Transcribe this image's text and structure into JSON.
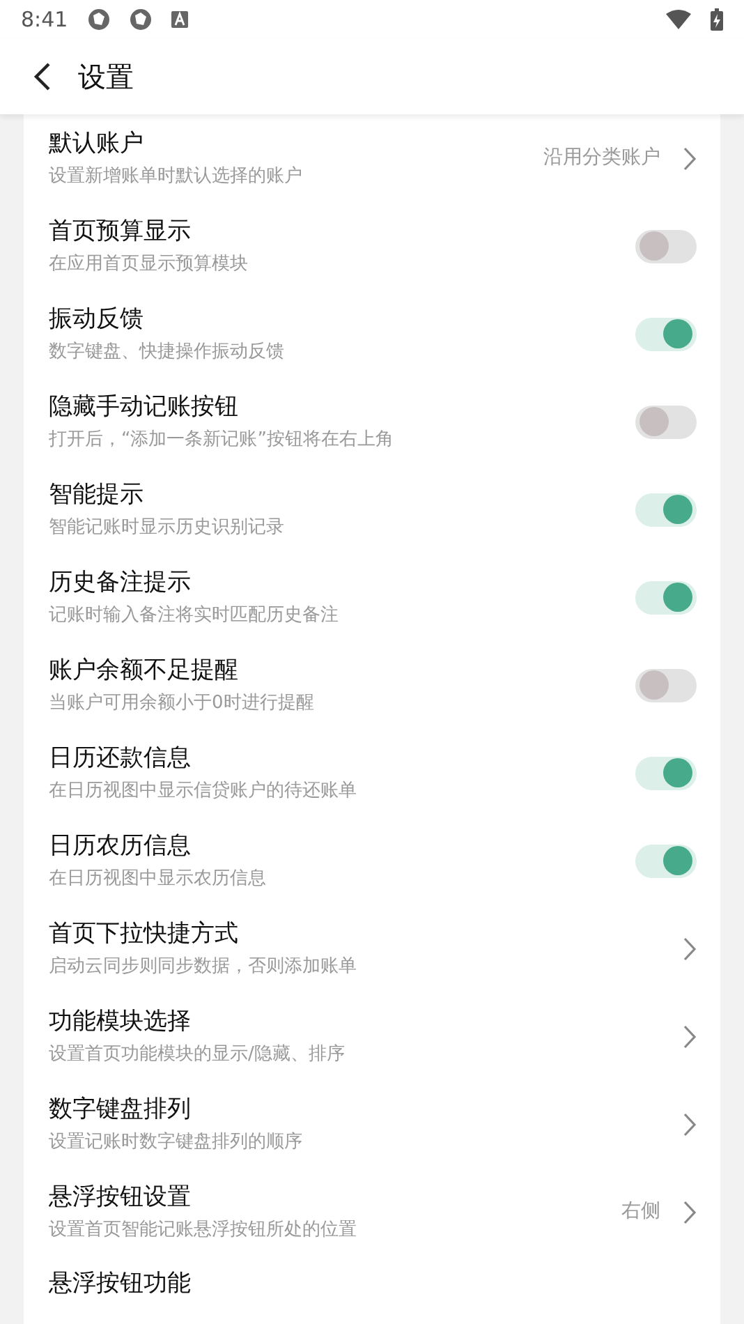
{
  "status_bar": {
    "time": "8:41"
  },
  "header": {
    "title": "设置"
  },
  "settings": [
    {
      "kind": "value",
      "title": "默认账户",
      "subtitle": "设置新增账单时默认选择的账户",
      "value": "沿用分类账户"
    },
    {
      "kind": "toggle",
      "title": "首页预算显示",
      "subtitle": "在应用首页显示预算模块",
      "on": false
    },
    {
      "kind": "toggle",
      "title": "振动反馈",
      "subtitle": "数字键盘、快捷操作振动反馈",
      "on": true
    },
    {
      "kind": "toggle",
      "title": "隐藏手动记账按钮",
      "subtitle": "打开后，“添加一条新记账”按钮将在右上角",
      "on": false
    },
    {
      "kind": "toggle",
      "title": "智能提示",
      "subtitle": "智能记账时显示历史识别记录",
      "on": true
    },
    {
      "kind": "toggle",
      "title": "历史备注提示",
      "subtitle": "记账时输入备注将实时匹配历史备注",
      "on": true
    },
    {
      "kind": "toggle",
      "title": "账户余额不足提醒",
      "subtitle": "当账户可用余额小于0时进行提醒",
      "on": false
    },
    {
      "kind": "toggle",
      "title": "日历还款信息",
      "subtitle": "在日历视图中显示信贷账户的待还账单",
      "on": true
    },
    {
      "kind": "toggle",
      "title": "日历农历信息",
      "subtitle": "在日历视图中显示农历信息",
      "on": true
    },
    {
      "kind": "link",
      "title": "首页下拉快捷方式",
      "subtitle": "启动云同步则同步数据，否则添加账单"
    },
    {
      "kind": "link",
      "title": "功能模块选择",
      "subtitle": "设置首页功能模块的显示/隐藏、排序"
    },
    {
      "kind": "link",
      "title": "数字键盘排列",
      "subtitle": "设置记账时数字键盘排列的顺序"
    },
    {
      "kind": "value",
      "title": "悬浮按钮设置",
      "subtitle": "设置首页智能记账悬浮按钮所处的位置",
      "value": "右侧"
    },
    {
      "kind": "title",
      "title": "悬浮按钮功能"
    }
  ]
}
